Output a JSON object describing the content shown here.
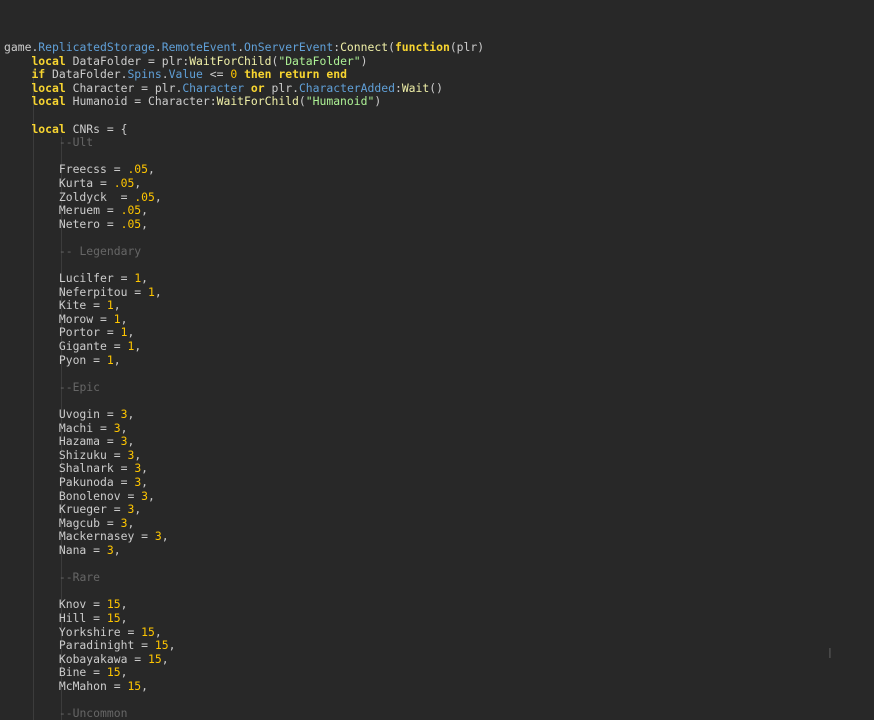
{
  "editor": {
    "lines": [
      [
        {
          "t": "game",
          "c": "id"
        },
        {
          "t": ".",
          "c": "op"
        },
        {
          "t": "ReplicatedStorage",
          "c": "prop"
        },
        {
          "t": ".",
          "c": "op"
        },
        {
          "t": "RemoteEvent",
          "c": "prop"
        },
        {
          "t": ".",
          "c": "op"
        },
        {
          "t": "OnServerEvent",
          "c": "prop"
        },
        {
          "t": ":",
          "c": "op"
        },
        {
          "t": "Connect",
          "c": "method"
        },
        {
          "t": "(",
          "c": "op"
        },
        {
          "t": "function",
          "c": "kw"
        },
        {
          "t": "(plr)",
          "c": "op"
        }
      ],
      [
        {
          "t": "    ",
          "c": "id"
        },
        {
          "t": "local",
          "c": "kw"
        },
        {
          "t": " DataFolder = plr:",
          "c": "id"
        },
        {
          "t": "WaitForChild",
          "c": "method"
        },
        {
          "t": "(",
          "c": "op"
        },
        {
          "t": "\"DataFolder\"",
          "c": "str"
        },
        {
          "t": ")",
          "c": "op"
        }
      ],
      [
        {
          "t": "    ",
          "c": "id"
        },
        {
          "t": "if",
          "c": "kw"
        },
        {
          "t": " DataFolder.",
          "c": "id"
        },
        {
          "t": "Spins",
          "c": "prop"
        },
        {
          "t": ".",
          "c": "op"
        },
        {
          "t": "Value",
          "c": "prop"
        },
        {
          "t": " <= ",
          "c": "op"
        },
        {
          "t": "0",
          "c": "num"
        },
        {
          "t": " ",
          "c": "id"
        },
        {
          "t": "then",
          "c": "kw"
        },
        {
          "t": " ",
          "c": "id"
        },
        {
          "t": "return",
          "c": "kw"
        },
        {
          "t": " ",
          "c": "id"
        },
        {
          "t": "end",
          "c": "kw"
        }
      ],
      [
        {
          "t": "    ",
          "c": "id"
        },
        {
          "t": "local",
          "c": "kw"
        },
        {
          "t": " Character = plr.",
          "c": "id"
        },
        {
          "t": "Character",
          "c": "prop"
        },
        {
          "t": " ",
          "c": "id"
        },
        {
          "t": "or",
          "c": "kw"
        },
        {
          "t": " plr.",
          "c": "id"
        },
        {
          "t": "CharacterAdded",
          "c": "prop"
        },
        {
          "t": ":",
          "c": "op"
        },
        {
          "t": "Wait",
          "c": "method"
        },
        {
          "t": "()",
          "c": "op"
        }
      ],
      [
        {
          "t": "    ",
          "c": "id"
        },
        {
          "t": "local",
          "c": "kw"
        },
        {
          "t": " Humanoid = Character:",
          "c": "id"
        },
        {
          "t": "WaitForChild",
          "c": "method"
        },
        {
          "t": "(",
          "c": "op"
        },
        {
          "t": "\"Humanoid\"",
          "c": "str"
        },
        {
          "t": ")",
          "c": "op"
        }
      ],
      [],
      [
        {
          "t": "    ",
          "c": "id"
        },
        {
          "t": "local",
          "c": "kw"
        },
        {
          "t": " CNRs = {",
          "c": "id"
        }
      ],
      [
        {
          "t": "        ",
          "c": "id"
        },
        {
          "t": "--Ult",
          "c": "cm"
        }
      ],
      [],
      [
        {
          "t": "        Freecss = ",
          "c": "id"
        },
        {
          "t": ".05",
          "c": "num"
        },
        {
          "t": ",",
          "c": "op"
        }
      ],
      [
        {
          "t": "        Kurta = ",
          "c": "id"
        },
        {
          "t": ".05",
          "c": "num"
        },
        {
          "t": ",",
          "c": "op"
        }
      ],
      [
        {
          "t": "        Zoldyck  = ",
          "c": "id"
        },
        {
          "t": ".05",
          "c": "num"
        },
        {
          "t": ",",
          "c": "op"
        }
      ],
      [
        {
          "t": "        Meruem = ",
          "c": "id"
        },
        {
          "t": ".05",
          "c": "num"
        },
        {
          "t": ",",
          "c": "op"
        }
      ],
      [
        {
          "t": "        Netero = ",
          "c": "id"
        },
        {
          "t": ".05",
          "c": "num"
        },
        {
          "t": ",",
          "c": "op"
        }
      ],
      [],
      [
        {
          "t": "        ",
          "c": "id"
        },
        {
          "t": "-- Legendary",
          "c": "cm"
        }
      ],
      [],
      [
        {
          "t": "        Lucilfer = ",
          "c": "id"
        },
        {
          "t": "1",
          "c": "num"
        },
        {
          "t": ",",
          "c": "op"
        }
      ],
      [
        {
          "t": "        Neferpitou = ",
          "c": "id"
        },
        {
          "t": "1",
          "c": "num"
        },
        {
          "t": ",",
          "c": "op"
        }
      ],
      [
        {
          "t": "        Kite = ",
          "c": "id"
        },
        {
          "t": "1",
          "c": "num"
        },
        {
          "t": ",",
          "c": "op"
        }
      ],
      [
        {
          "t": "        Morow = ",
          "c": "id"
        },
        {
          "t": "1",
          "c": "num"
        },
        {
          "t": ",",
          "c": "op"
        }
      ],
      [
        {
          "t": "        Portor = ",
          "c": "id"
        },
        {
          "t": "1",
          "c": "num"
        },
        {
          "t": ",",
          "c": "op"
        }
      ],
      [
        {
          "t": "        Gigante = ",
          "c": "id"
        },
        {
          "t": "1",
          "c": "num"
        },
        {
          "t": ",",
          "c": "op"
        }
      ],
      [
        {
          "t": "        Pyon = ",
          "c": "id"
        },
        {
          "t": "1",
          "c": "num"
        },
        {
          "t": ",",
          "c": "op"
        }
      ],
      [],
      [
        {
          "t": "        ",
          "c": "id"
        },
        {
          "t": "--Epic",
          "c": "cm"
        }
      ],
      [],
      [
        {
          "t": "        Uvogin = ",
          "c": "id"
        },
        {
          "t": "3",
          "c": "num"
        },
        {
          "t": ",",
          "c": "op"
        }
      ],
      [
        {
          "t": "        Machi = ",
          "c": "id"
        },
        {
          "t": "3",
          "c": "num"
        },
        {
          "t": ",",
          "c": "op"
        }
      ],
      [
        {
          "t": "        Hazama = ",
          "c": "id"
        },
        {
          "t": "3",
          "c": "num"
        },
        {
          "t": ",",
          "c": "op"
        }
      ],
      [
        {
          "t": "        Shizuku = ",
          "c": "id"
        },
        {
          "t": "3",
          "c": "num"
        },
        {
          "t": ",",
          "c": "op"
        }
      ],
      [
        {
          "t": "        Shalnark = ",
          "c": "id"
        },
        {
          "t": "3",
          "c": "num"
        },
        {
          "t": ",",
          "c": "op"
        }
      ],
      [
        {
          "t": "        Pakunoda = ",
          "c": "id"
        },
        {
          "t": "3",
          "c": "num"
        },
        {
          "t": ",",
          "c": "op"
        }
      ],
      [
        {
          "t": "        Bonolenov = ",
          "c": "id"
        },
        {
          "t": "3",
          "c": "num"
        },
        {
          "t": ",",
          "c": "op"
        }
      ],
      [
        {
          "t": "        Krueger = ",
          "c": "id"
        },
        {
          "t": "3",
          "c": "num"
        },
        {
          "t": ",",
          "c": "op"
        }
      ],
      [
        {
          "t": "        Magcub = ",
          "c": "id"
        },
        {
          "t": "3",
          "c": "num"
        },
        {
          "t": ",",
          "c": "op"
        }
      ],
      [
        {
          "t": "        Mackernasey = ",
          "c": "id"
        },
        {
          "t": "3",
          "c": "num"
        },
        {
          "t": ",",
          "c": "op"
        }
      ],
      [
        {
          "t": "        Nana = ",
          "c": "id"
        },
        {
          "t": "3",
          "c": "num"
        },
        {
          "t": ",",
          "c": "op"
        }
      ],
      [],
      [
        {
          "t": "        ",
          "c": "id"
        },
        {
          "t": "--Rare",
          "c": "cm"
        }
      ],
      [],
      [
        {
          "t": "        Knov = ",
          "c": "id"
        },
        {
          "t": "15",
          "c": "num"
        },
        {
          "t": ",",
          "c": "op"
        }
      ],
      [
        {
          "t": "        Hill = ",
          "c": "id"
        },
        {
          "t": "15",
          "c": "num"
        },
        {
          "t": ",",
          "c": "op"
        }
      ],
      [
        {
          "t": "        Yorkshire = ",
          "c": "id"
        },
        {
          "t": "15",
          "c": "num"
        },
        {
          "t": ",",
          "c": "op"
        }
      ],
      [
        {
          "t": "        Paradinight = ",
          "c": "id"
        },
        {
          "t": "15",
          "c": "num"
        },
        {
          "t": ",",
          "c": "op"
        }
      ],
      [
        {
          "t": "        Kobayakawa = ",
          "c": "id"
        },
        {
          "t": "15",
          "c": "num"
        },
        {
          "t": ",",
          "c": "op"
        }
      ],
      [
        {
          "t": "        Bine = ",
          "c": "id"
        },
        {
          "t": "15",
          "c": "num"
        },
        {
          "t": ",",
          "c": "op"
        }
      ],
      [
        {
          "t": "        McMahon = ",
          "c": "id"
        },
        {
          "t": "15",
          "c": "num"
        },
        {
          "t": ",",
          "c": "op"
        }
      ],
      [],
      [
        {
          "t": "        ",
          "c": "id"
        },
        {
          "t": "--Uncommon",
          "c": "cm"
        }
      ]
    ],
    "colors": {
      "background": "#282828",
      "keyword": "#f8d530",
      "property": "#60a0d8",
      "method": "#f0f0a8",
      "string": "#adf195",
      "number": "#ffc600",
      "comment": "#666666",
      "identifier": "#cccccc"
    },
    "caret_icon": "text-cursor-icon"
  }
}
